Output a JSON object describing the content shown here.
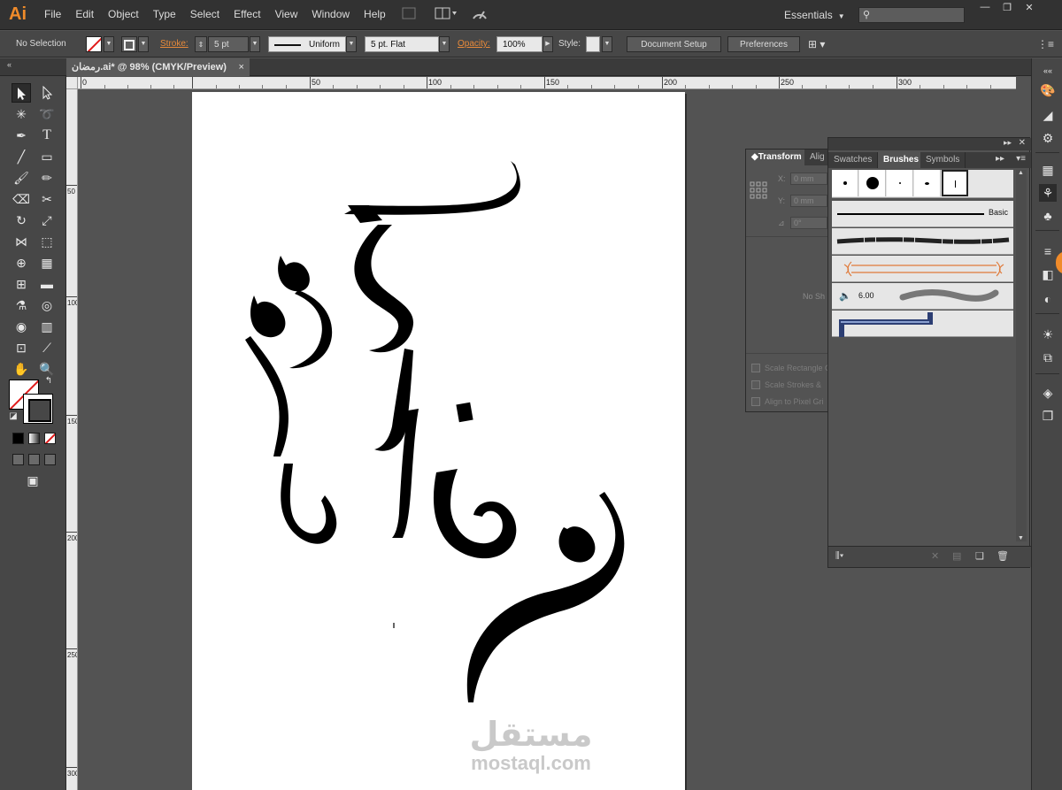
{
  "app": {
    "logo": "Ai"
  },
  "menubar": {
    "items": [
      "File",
      "Edit",
      "Object",
      "Type",
      "Select",
      "Effect",
      "View",
      "Window",
      "Help"
    ],
    "workspace": "Essentials",
    "search_placeholder": ""
  },
  "control_bar": {
    "selection": "No Selection",
    "stroke_label": "Stroke:",
    "stroke_weight": "5 pt",
    "profile": "Uniform",
    "brush_def": "5 pt. Flat",
    "opacity_label": "Opacity:",
    "opacity_value": "100%",
    "style_label": "Style:",
    "document_setup": "Document Setup",
    "preferences": "Preferences"
  },
  "document": {
    "tab_title": "رمضان.ai* @ 98% (CMYK/Preview)",
    "close": "×"
  },
  "rulers": {
    "top_labels": [
      "0",
      "50",
      "100",
      "150",
      "200",
      "250",
      "300"
    ],
    "left_labels": [
      "50",
      "100",
      "150",
      "200",
      "250",
      "300"
    ]
  },
  "artwork": {
    "calligraphy_text": "رمضان كريم"
  },
  "watermark": {
    "arabic": "مستقل",
    "latin": "mostaql.com"
  },
  "transform_panel": {
    "tabs": [
      "Transform",
      "Alig"
    ],
    "x_label": "X:",
    "x_value": "0 mm",
    "y_label": "Y:",
    "y_value": "0 mm",
    "angle_value": "0°",
    "no_selection": "No Sh",
    "options": [
      "Scale Rectangle C",
      "Scale Strokes &",
      "Align to Pixel Gri"
    ]
  },
  "brushes_panel": {
    "tabs": [
      "Swatches",
      "Brushes",
      "Symbols"
    ],
    "basic_label": "Basic",
    "bristle_value": "6.00"
  },
  "colors": {
    "accent": "#f08b2a",
    "menubar": "#323232",
    "panel": "#535353",
    "none_red": "#e01a1a"
  }
}
